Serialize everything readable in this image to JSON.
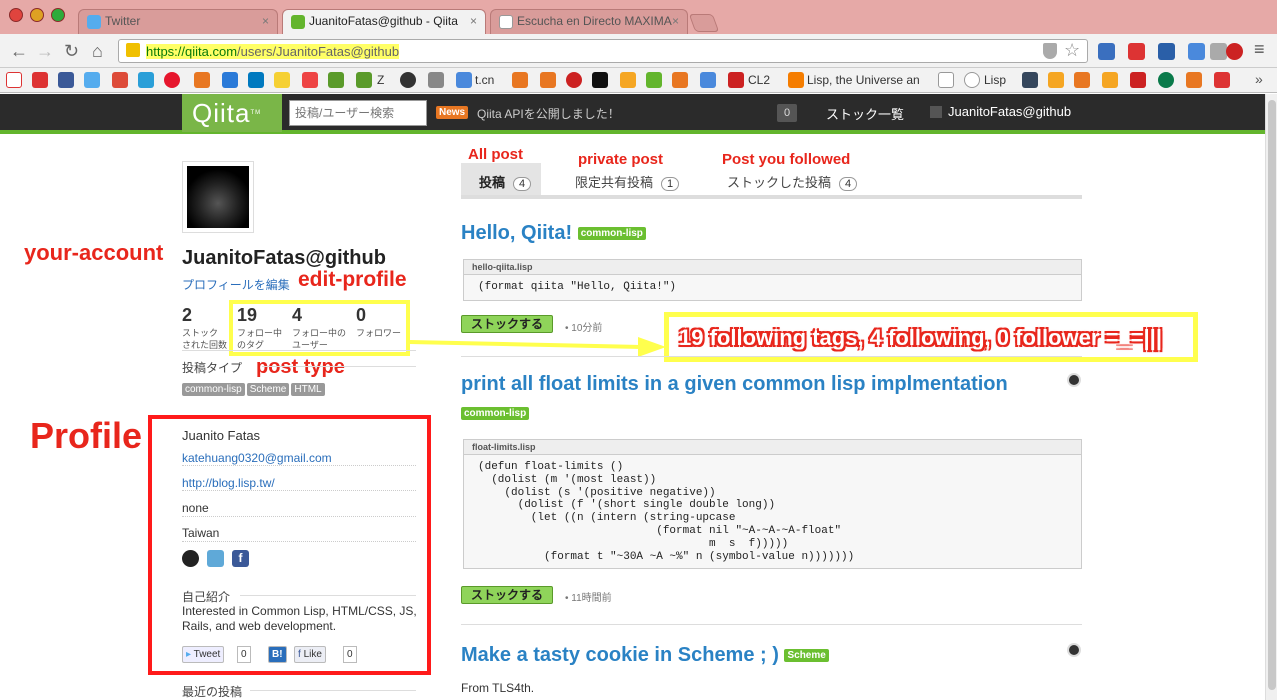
{
  "browser": {
    "tabs": [
      {
        "label": "Twitter"
      },
      {
        "label": "JuanitoFatas@github - Qiita"
      },
      {
        "label": "Escucha en Directo MAXIMA"
      }
    ],
    "url_host": "https://qiita.com",
    "url_path": "/users/JuanitoFatas@github"
  },
  "bookmarks": [
    {
      "label": "Z"
    },
    {
      "label": "t.cn"
    },
    {
      "label": "CL2"
    },
    {
      "label": "Lisp, the Universe an"
    },
    {
      "label": "Lisp"
    }
  ],
  "qiita_header": {
    "logo": "Qiita",
    "logo_tm": "TM",
    "search_placeholder": "投稿/ユーザー検索",
    "news_badge": "News",
    "news_text": "Qiita APIを公開しました！",
    "count": "0",
    "stock_list": "ストック一覧",
    "user": "JuanitoFatas@github"
  },
  "annotations": {
    "your_account": "your-account",
    "edit_profile": "edit-profile",
    "post_type": "post type",
    "profile": "Profile",
    "all_post": "All post",
    "private_post": "private post",
    "post_followed": "Post you followed",
    "follow_note": "19 following tags, 4 following, 0 follower =_=|||"
  },
  "profile": {
    "username": "JuanitoFatas@github",
    "edit_link": "プロフィールを編集",
    "stats": [
      {
        "value": "2",
        "label1": "ストック",
        "label2": "された回数"
      },
      {
        "value": "19",
        "label1": "フォロー中",
        "label2": "のタグ"
      },
      {
        "value": "4",
        "label1": "フォロー中の",
        "label2": "ユーザー"
      },
      {
        "value": "0",
        "label1": "フォロワー",
        "label2": ""
      }
    ],
    "post_type_heading": "投稿タイプ",
    "post_types": [
      "common-lisp",
      "Scheme",
      "HTML"
    ],
    "name": "Juanito Fatas",
    "email": "katehuang0320@gmail.com",
    "blog": "http://blog.lisp.tw/",
    "company": "none",
    "location": "Taiwan",
    "intro_heading": "自己紹介",
    "intro": "Interested in Common Lisp, HTML/CSS, JS, Rails, and web development.",
    "tweet": "Tweet",
    "tweet_count": "0",
    "hatena": "B!",
    "like": "Like",
    "like_count": "0",
    "recent_heading": "最近の投稿"
  },
  "post_tabs": [
    {
      "label": "投稿",
      "count": "4"
    },
    {
      "label": "限定共有投稿",
      "count": "1"
    },
    {
      "label": "ストックした投稿",
      "count": "4"
    }
  ],
  "posts": [
    {
      "title": "Hello, Qiita!",
      "tag": "common-lisp",
      "file": "hello-qiita.lisp",
      "code": "(format qiita \"Hello, Qiita!\")",
      "stock": "ストックする",
      "time": "10分前"
    },
    {
      "title": "print all float limits in a given common lisp implmentation",
      "tag": "common-lisp",
      "file": "float-limits.lisp",
      "code": "(defun float-limits ()\n  (dolist (m '(most least))\n    (dolist (s '(positive negative))\n      (dolist (f '(short single double long))\n        (let ((n (intern (string-upcase\n                           (format nil \"~A-~A-~A-float\"\n                                   m  s  f)))))\n          (format t \"~30A ~A ~%\" n (symbol-value n)))))))",
      "stock": "ストックする",
      "time": "11時間前"
    },
    {
      "title": "Make a tasty cookie in Scheme ; )",
      "tag": "Scheme",
      "snippet": "From TLS4th."
    }
  ]
}
